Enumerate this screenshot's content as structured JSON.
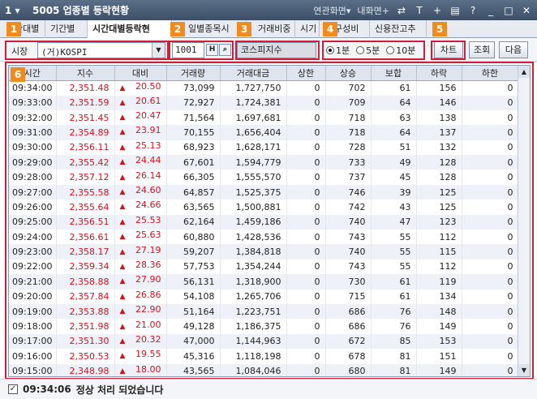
{
  "titlebar": {
    "screen_no": "1",
    "title": "5005 업종별 등락현황",
    "menu_linked": "연관화면▾",
    "menu_my": "내화면+",
    "icons": [
      "link-icon",
      "text-icon",
      "plus-icon",
      "print-icon",
      "help-icon",
      "minimize-icon",
      "maximize-icon",
      "close-icon"
    ]
  },
  "tabs": [
    "간대별",
    "기간별",
    "시간대별등락현",
    "일별종목시",
    "거래비중",
    "시기",
    "구성비",
    "신용잔고추"
  ],
  "toolbar": {
    "market_label": "시장",
    "market_value": "(거)KOSPI",
    "code_value": "1001",
    "h_button": "H",
    "search_button": "🔍",
    "index_name": "코스피지수",
    "radios": [
      {
        "label": "1분",
        "selected": true
      },
      {
        "label": "5분",
        "selected": false
      },
      {
        "label": "10분",
        "selected": false
      }
    ],
    "chart_button": "차트",
    "query_button": "조회",
    "next_button": "다음"
  },
  "callouts": [
    "1",
    "2",
    "3",
    "4",
    "5",
    "6"
  ],
  "table": {
    "columns": [
      "시간",
      "지수",
      "대비",
      "거래량",
      "거래대금",
      "상한",
      "상승",
      "보합",
      "하락",
      "하한"
    ],
    "rows": [
      [
        "09:34:00",
        "2,351.48",
        "20.50",
        "73,099",
        "1,727,750",
        "0",
        "702",
        "61",
        "156",
        "0"
      ],
      [
        "09:33:00",
        "2,351.59",
        "20.61",
        "72,927",
        "1,724,381",
        "0",
        "709",
        "64",
        "146",
        "0"
      ],
      [
        "09:32:00",
        "2,351.45",
        "20.47",
        "71,564",
        "1,697,681",
        "0",
        "718",
        "63",
        "138",
        "0"
      ],
      [
        "09:31:00",
        "2,354.89",
        "23.91",
        "70,155",
        "1,656,404",
        "0",
        "718",
        "64",
        "137",
        "0"
      ],
      [
        "09:30:00",
        "2,356.11",
        "25.13",
        "68,923",
        "1,628,171",
        "0",
        "728",
        "51",
        "132",
        "0"
      ],
      [
        "09:29:00",
        "2,355.42",
        "24.44",
        "67,601",
        "1,594,779",
        "0",
        "733",
        "49",
        "128",
        "0"
      ],
      [
        "09:28:00",
        "2,357.12",
        "26.14",
        "66,305",
        "1,555,570",
        "0",
        "737",
        "45",
        "128",
        "0"
      ],
      [
        "09:27:00",
        "2,355.58",
        "24.60",
        "64,857",
        "1,525,375",
        "0",
        "746",
        "39",
        "125",
        "0"
      ],
      [
        "09:26:00",
        "2,355.64",
        "24.66",
        "63,565",
        "1,500,881",
        "0",
        "742",
        "43",
        "125",
        "0"
      ],
      [
        "09:25:00",
        "2,356.51",
        "25.53",
        "62,164",
        "1,459,186",
        "0",
        "740",
        "47",
        "123",
        "0"
      ],
      [
        "09:24:00",
        "2,356.61",
        "25.63",
        "60,880",
        "1,428,536",
        "0",
        "743",
        "55",
        "112",
        "0"
      ],
      [
        "09:23:00",
        "2,358.17",
        "27.19",
        "59,207",
        "1,384,818",
        "0",
        "740",
        "55",
        "115",
        "0"
      ],
      [
        "09:22:00",
        "2,359.34",
        "28.36",
        "57,753",
        "1,354,244",
        "0",
        "743",
        "55",
        "112",
        "0"
      ],
      [
        "09:21:00",
        "2,358.88",
        "27.90",
        "56,131",
        "1,318,900",
        "0",
        "730",
        "61",
        "119",
        "0"
      ],
      [
        "09:20:00",
        "2,357.84",
        "26.86",
        "54,108",
        "1,265,706",
        "0",
        "715",
        "61",
        "134",
        "0"
      ],
      [
        "09:19:00",
        "2,353.88",
        "22.90",
        "51,164",
        "1,223,751",
        "0",
        "686",
        "76",
        "148",
        "0"
      ],
      [
        "09:18:00",
        "2,351.98",
        "21.00",
        "49,128",
        "1,186,375",
        "0",
        "686",
        "76",
        "149",
        "0"
      ],
      [
        "09:17:00",
        "2,351.30",
        "20.32",
        "47,000",
        "1,144,963",
        "0",
        "672",
        "85",
        "153",
        "0"
      ],
      [
        "09:16:00",
        "2,350.53",
        "19.55",
        "45,316",
        "1,118,198",
        "0",
        "678",
        "81",
        "151",
        "0"
      ],
      [
        "09:15:00",
        "2,348.98",
        "18.00",
        "43,565",
        "1,084,046",
        "0",
        "680",
        "81",
        "149",
        "0"
      ]
    ]
  },
  "status": {
    "checked": true,
    "time": "09:34:06",
    "message": "정상 처리 되었습니다"
  },
  "colors": {
    "up_red": "#d0131e",
    "callout_orange": "#f08c1e",
    "highlight_box": "#cc1f39",
    "titlebar": "#4a5d77"
  }
}
